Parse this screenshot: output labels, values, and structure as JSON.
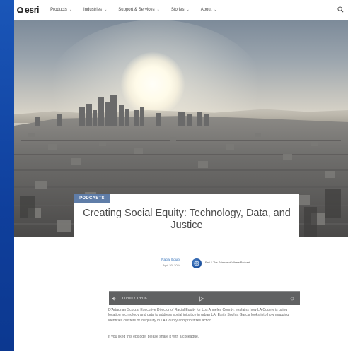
{
  "nav": {
    "logo_text": "esri",
    "items": [
      {
        "label": "Products"
      },
      {
        "label": "Industries"
      },
      {
        "label": "Support & Services"
      },
      {
        "label": "Stories"
      },
      {
        "label": "About"
      }
    ],
    "search_icon": "search-icon"
  },
  "article": {
    "category_tag": "PODCASTS",
    "title": "Creating Social Equity: Technology, Data, and Justice",
    "meta": {
      "category": "Racial Equity",
      "date": "April 30, 2024",
      "podcast_name": "Esri & The Science of Where Podcast"
    },
    "player": {
      "time": "00:00 / 13:06"
    },
    "description": "D'Artagnan Scorza, Executive Director of Racial Equity for Los Angeles County, explains how LA County is using location technology and data to address social injustice in urban LA. Esri's Sophia Garcia looks into how mapping identifies clusters of inequality in LA County and prioritizes action.",
    "share_text": "If you liked this episode, please share it with a colleague."
  },
  "colors": {
    "background": "#1246a6",
    "tag": "#5f7da8",
    "player": "#606162",
    "link": "#2b6cb7"
  }
}
